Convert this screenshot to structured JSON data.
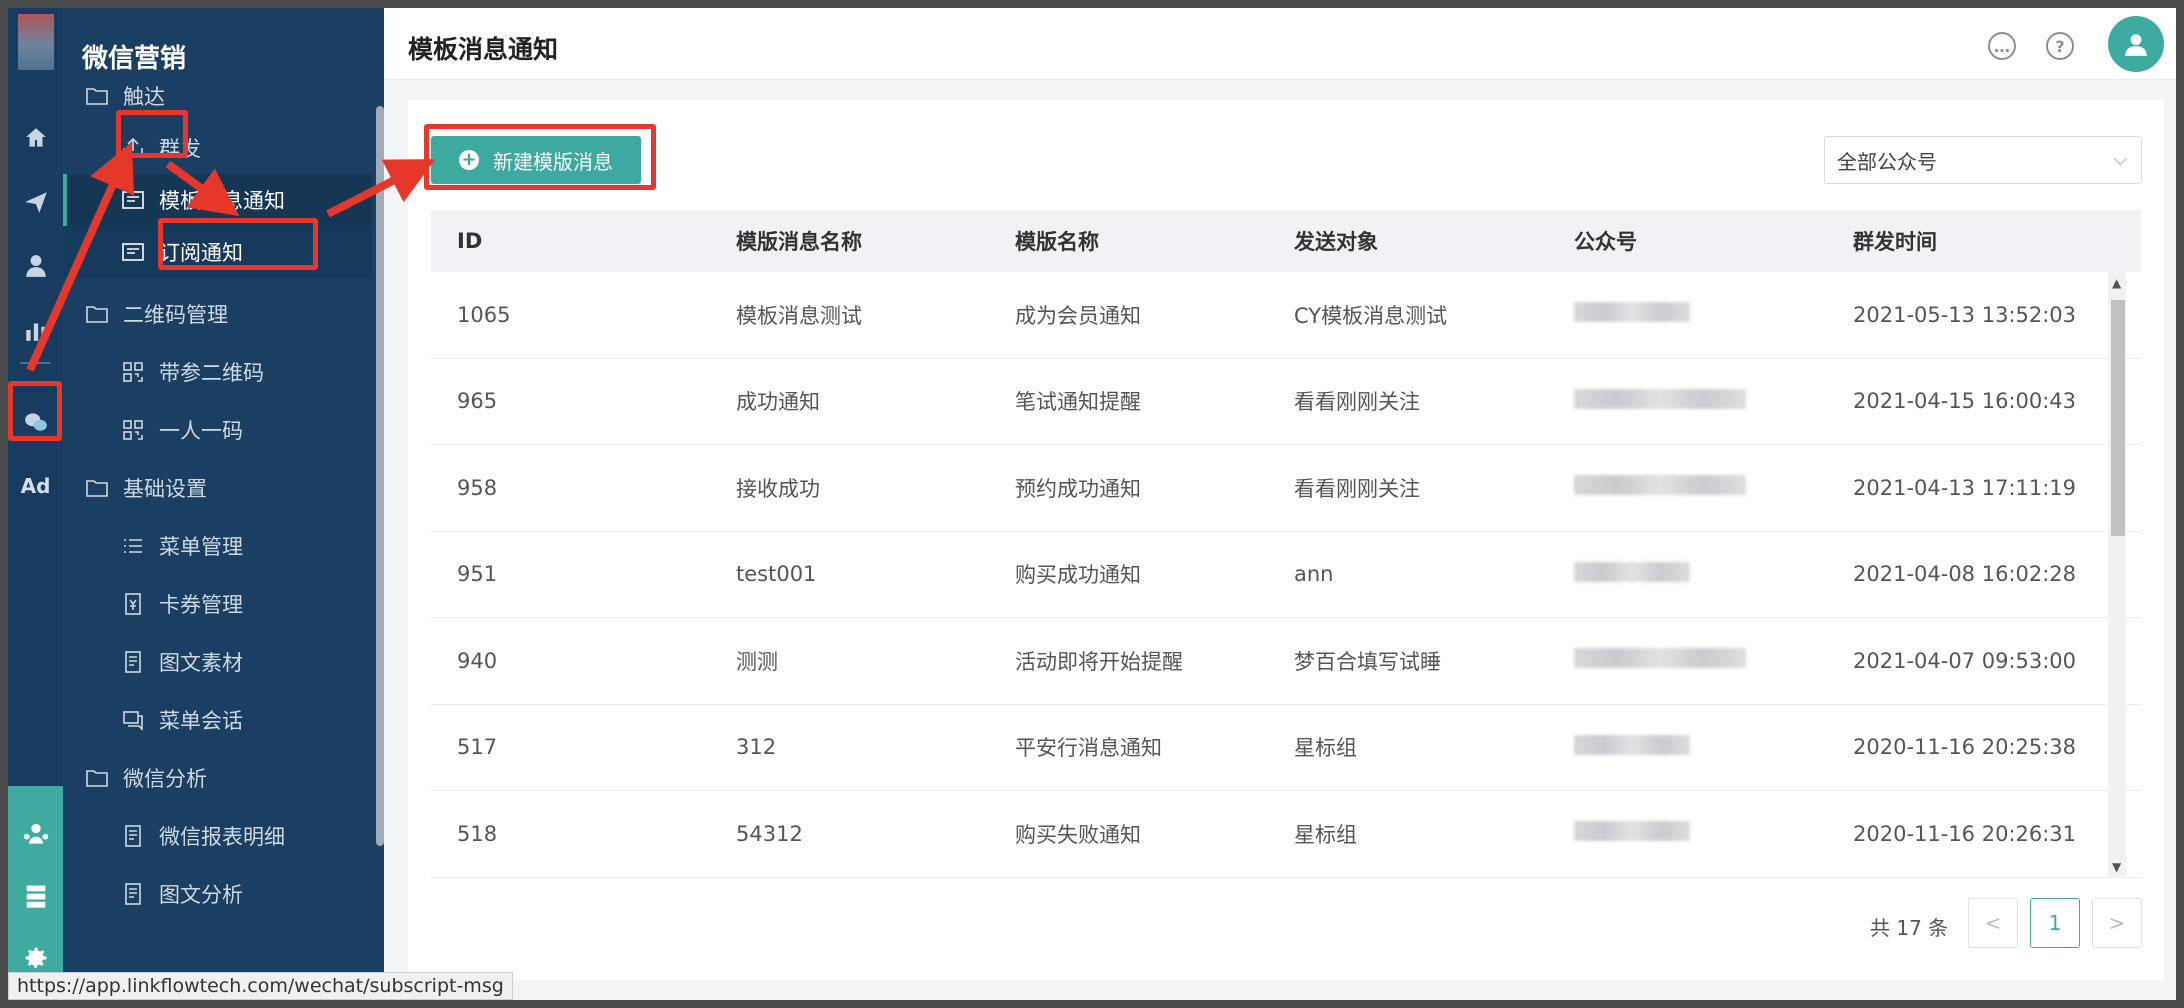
{
  "sidebar": {
    "title": "微信营销",
    "items": [
      {
        "label": "触达",
        "icon": "folder-icon"
      },
      {
        "label": "群发",
        "icon": "upload-icon"
      },
      {
        "label": "模板消息通知",
        "icon": "message-icon"
      },
      {
        "label": "订阅通知",
        "icon": "message-icon"
      },
      {
        "label": "二维码管理",
        "icon": "folder-icon"
      },
      {
        "label": "带参二维码",
        "icon": "qrcode-icon"
      },
      {
        "label": "一人一码",
        "icon": "qrcode-icon"
      },
      {
        "label": "基础设置",
        "icon": "folder-icon"
      },
      {
        "label": "菜单管理",
        "icon": "list-icon"
      },
      {
        "label": "卡券管理",
        "icon": "coupon-icon"
      },
      {
        "label": "图文素材",
        "icon": "document-icon"
      },
      {
        "label": "菜单会话",
        "icon": "chat-icon"
      },
      {
        "label": "微信分析",
        "icon": "folder-icon"
      },
      {
        "label": "微信报表明细",
        "icon": "document-icon"
      },
      {
        "label": "图文分析",
        "icon": "document-icon"
      }
    ]
  },
  "rail": {
    "ad_label": "Ad"
  },
  "header": {
    "title": "模板消息通知"
  },
  "toolbar": {
    "new_button": "新建模版消息",
    "account_select": "全部公众号"
  },
  "table": {
    "columns": [
      "ID",
      "模版消息名称",
      "模版名称",
      "发送对象",
      "公众号",
      "群发时间"
    ],
    "rows": [
      {
        "id": "1065",
        "msg_name": "模板消息测试",
        "template": "成为会员通知",
        "target": "CY模板消息测试",
        "time": "2021-05-13 13:52:03"
      },
      {
        "id": "965",
        "msg_name": "成功通知",
        "template": "笔试通知提醒",
        "target": "看看刚刚关注",
        "time": "2021-04-15 16:00:43"
      },
      {
        "id": "958",
        "msg_name": "接收成功",
        "template": "预约成功通知",
        "target": "看看刚刚关注",
        "time": "2021-04-13 17:11:19"
      },
      {
        "id": "951",
        "msg_name": "test001",
        "template": "购买成功通知",
        "target": "ann",
        "time": "2021-04-08 16:02:28"
      },
      {
        "id": "940",
        "msg_name": "测测",
        "template": "活动即将开始提醒",
        "target": "梦百合填写试睡",
        "time": "2021-04-07 09:53:00"
      },
      {
        "id": "517",
        "msg_name": "312",
        "template": "平安行消息通知",
        "target": "星标组",
        "time": "2020-11-16 20:25:38"
      },
      {
        "id": "518",
        "msg_name": "54312",
        "template": "购买失败通知",
        "target": "星标组",
        "time": "2020-11-16 20:26:31"
      }
    ]
  },
  "pagination": {
    "total": "共 17 条",
    "prev": "<",
    "current": "1",
    "next": ">"
  },
  "status_url": "https://app.linkflowtech.com/wechat/subscript-msg",
  "colors": {
    "accent": "#3ea99f",
    "sidebar_bg": "#1b3f62",
    "annotation": "#e6372b"
  }
}
